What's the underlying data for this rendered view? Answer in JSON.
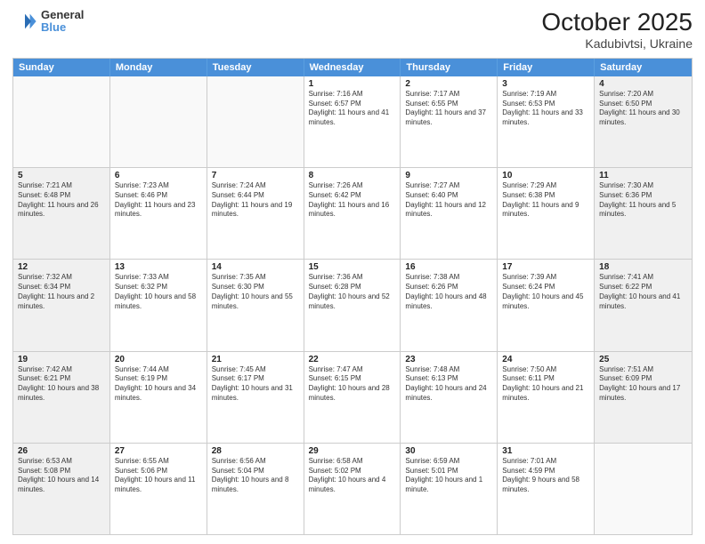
{
  "header": {
    "logo_line1": "General",
    "logo_line2": "Blue",
    "title": "October 2025",
    "subtitle": "Kadubivtsi, Ukraine"
  },
  "weekdays": [
    "Sunday",
    "Monday",
    "Tuesday",
    "Wednesday",
    "Thursday",
    "Friday",
    "Saturday"
  ],
  "rows": [
    [
      {
        "day": "",
        "text": "",
        "empty": true
      },
      {
        "day": "",
        "text": "",
        "empty": true
      },
      {
        "day": "",
        "text": "",
        "empty": true
      },
      {
        "day": "1",
        "text": "Sunrise: 7:16 AM\nSunset: 6:57 PM\nDaylight: 11 hours and 41 minutes."
      },
      {
        "day": "2",
        "text": "Sunrise: 7:17 AM\nSunset: 6:55 PM\nDaylight: 11 hours and 37 minutes."
      },
      {
        "day": "3",
        "text": "Sunrise: 7:19 AM\nSunset: 6:53 PM\nDaylight: 11 hours and 33 minutes."
      },
      {
        "day": "4",
        "text": "Sunrise: 7:20 AM\nSunset: 6:50 PM\nDaylight: 11 hours and 30 minutes.",
        "shaded": true
      }
    ],
    [
      {
        "day": "5",
        "text": "Sunrise: 7:21 AM\nSunset: 6:48 PM\nDaylight: 11 hours and 26 minutes.",
        "shaded": true
      },
      {
        "day": "6",
        "text": "Sunrise: 7:23 AM\nSunset: 6:46 PM\nDaylight: 11 hours and 23 minutes."
      },
      {
        "day": "7",
        "text": "Sunrise: 7:24 AM\nSunset: 6:44 PM\nDaylight: 11 hours and 19 minutes."
      },
      {
        "day": "8",
        "text": "Sunrise: 7:26 AM\nSunset: 6:42 PM\nDaylight: 11 hours and 16 minutes."
      },
      {
        "day": "9",
        "text": "Sunrise: 7:27 AM\nSunset: 6:40 PM\nDaylight: 11 hours and 12 minutes."
      },
      {
        "day": "10",
        "text": "Sunrise: 7:29 AM\nSunset: 6:38 PM\nDaylight: 11 hours and 9 minutes."
      },
      {
        "day": "11",
        "text": "Sunrise: 7:30 AM\nSunset: 6:36 PM\nDaylight: 11 hours and 5 minutes.",
        "shaded": true
      }
    ],
    [
      {
        "day": "12",
        "text": "Sunrise: 7:32 AM\nSunset: 6:34 PM\nDaylight: 11 hours and 2 minutes.",
        "shaded": true
      },
      {
        "day": "13",
        "text": "Sunrise: 7:33 AM\nSunset: 6:32 PM\nDaylight: 10 hours and 58 minutes."
      },
      {
        "day": "14",
        "text": "Sunrise: 7:35 AM\nSunset: 6:30 PM\nDaylight: 10 hours and 55 minutes."
      },
      {
        "day": "15",
        "text": "Sunrise: 7:36 AM\nSunset: 6:28 PM\nDaylight: 10 hours and 52 minutes."
      },
      {
        "day": "16",
        "text": "Sunrise: 7:38 AM\nSunset: 6:26 PM\nDaylight: 10 hours and 48 minutes."
      },
      {
        "day": "17",
        "text": "Sunrise: 7:39 AM\nSunset: 6:24 PM\nDaylight: 10 hours and 45 minutes."
      },
      {
        "day": "18",
        "text": "Sunrise: 7:41 AM\nSunset: 6:22 PM\nDaylight: 10 hours and 41 minutes.",
        "shaded": true
      }
    ],
    [
      {
        "day": "19",
        "text": "Sunrise: 7:42 AM\nSunset: 6:21 PM\nDaylight: 10 hours and 38 minutes.",
        "shaded": true
      },
      {
        "day": "20",
        "text": "Sunrise: 7:44 AM\nSunset: 6:19 PM\nDaylight: 10 hours and 34 minutes."
      },
      {
        "day": "21",
        "text": "Sunrise: 7:45 AM\nSunset: 6:17 PM\nDaylight: 10 hours and 31 minutes."
      },
      {
        "day": "22",
        "text": "Sunrise: 7:47 AM\nSunset: 6:15 PM\nDaylight: 10 hours and 28 minutes."
      },
      {
        "day": "23",
        "text": "Sunrise: 7:48 AM\nSunset: 6:13 PM\nDaylight: 10 hours and 24 minutes."
      },
      {
        "day": "24",
        "text": "Sunrise: 7:50 AM\nSunset: 6:11 PM\nDaylight: 10 hours and 21 minutes."
      },
      {
        "day": "25",
        "text": "Sunrise: 7:51 AM\nSunset: 6:09 PM\nDaylight: 10 hours and 17 minutes.",
        "shaded": true
      }
    ],
    [
      {
        "day": "26",
        "text": "Sunrise: 6:53 AM\nSunset: 5:08 PM\nDaylight: 10 hours and 14 minutes.",
        "shaded": true
      },
      {
        "day": "27",
        "text": "Sunrise: 6:55 AM\nSunset: 5:06 PM\nDaylight: 10 hours and 11 minutes."
      },
      {
        "day": "28",
        "text": "Sunrise: 6:56 AM\nSunset: 5:04 PM\nDaylight: 10 hours and 8 minutes."
      },
      {
        "day": "29",
        "text": "Sunrise: 6:58 AM\nSunset: 5:02 PM\nDaylight: 10 hours and 4 minutes."
      },
      {
        "day": "30",
        "text": "Sunrise: 6:59 AM\nSunset: 5:01 PM\nDaylight: 10 hours and 1 minute."
      },
      {
        "day": "31",
        "text": "Sunrise: 7:01 AM\nSunset: 4:59 PM\nDaylight: 9 hours and 58 minutes."
      },
      {
        "day": "",
        "text": "",
        "empty": true
      }
    ]
  ]
}
